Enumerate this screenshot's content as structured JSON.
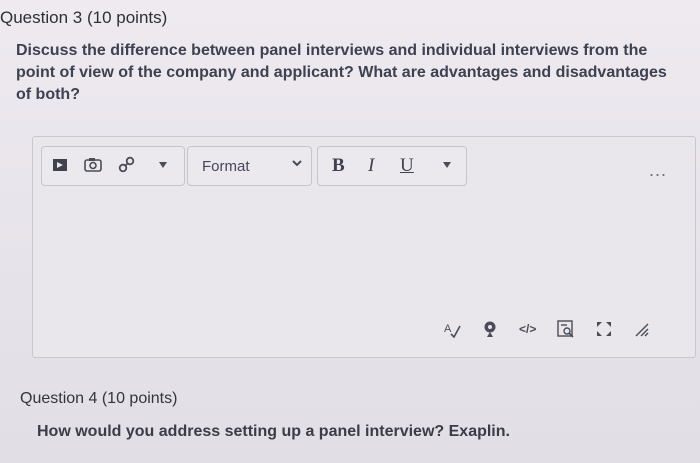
{
  "question3": {
    "label": "Question 3",
    "points": "(10 points)",
    "text": "Discuss the difference between panel interviews and individual interviews from the point of view of the company and applicant? What are advantages and disadvantages of both?"
  },
  "toolbar": {
    "format_label": "Format",
    "bold": "B",
    "italic": "I",
    "underline": "U",
    "more": "..."
  },
  "editor_footer": {
    "html_source": "</>"
  },
  "question4": {
    "label": "Question 4",
    "points": "(10 points)",
    "text": "How would you address setting up a panel interview? Exaplin."
  }
}
